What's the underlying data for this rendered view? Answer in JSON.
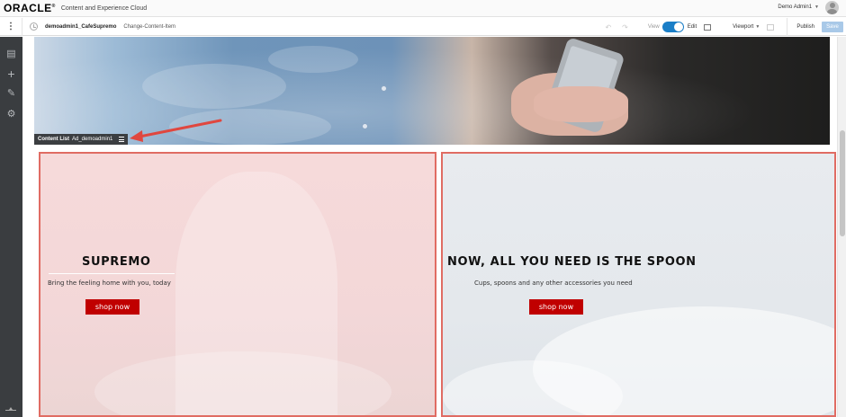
{
  "header": {
    "logo": "ORACLE",
    "product": "Content and Experience Cloud",
    "user_name": "Demo Admin1"
  },
  "toolbar": {
    "site_name": "demoadmin1_CafeSupremo",
    "page_name": "Change-Content-Item",
    "view_label": "View",
    "edit_label": "Edit",
    "viewport_label": "Viewport",
    "publish_label": "Publish",
    "save_label": "Save",
    "mode": "Edit"
  },
  "colors": {
    "accent": "#1a7ec7",
    "rail": "#3a3d40",
    "highlight_border": "#e06c63",
    "shop_button": "#c00000"
  },
  "leftrail": {
    "icons": [
      "layout-icon",
      "add-icon",
      "brush-icon",
      "settings-icon"
    ]
  },
  "content_list": {
    "label": "Content List",
    "name": "Ad_demoadmin1"
  },
  "panels": [
    {
      "title": "SUPREMO",
      "subtitle": "Bring the feeling home with you, today",
      "button": "shop now"
    },
    {
      "title": "NOW, ALL YOU NEED IS THE SPOON",
      "subtitle": "Cups, spoons and any other accessories you need",
      "button": "shop now"
    }
  ]
}
